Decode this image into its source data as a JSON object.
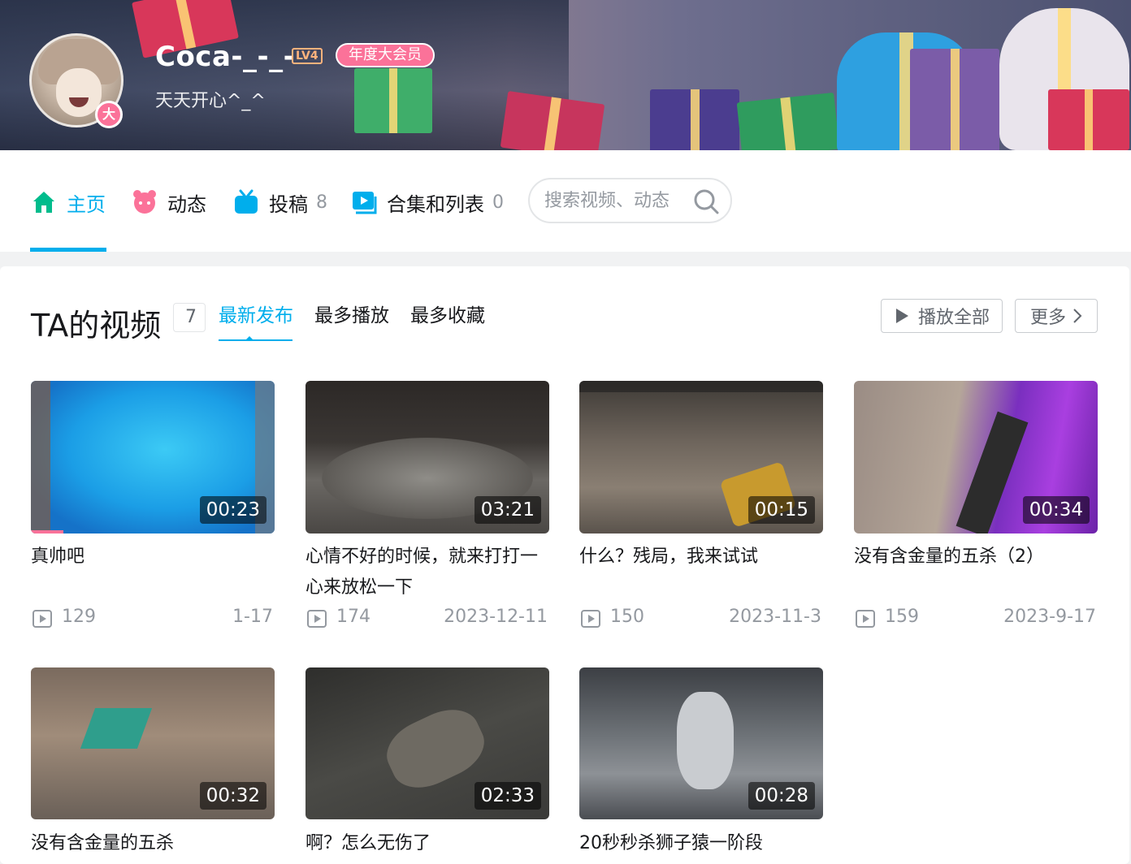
{
  "profile": {
    "username": "Coca-_-_-",
    "level": "LV4",
    "vip_label": "年度大会员",
    "vip_badge": "大",
    "signature": "天天开心^_^"
  },
  "nav": {
    "items": [
      {
        "label": "主页",
        "icon": "home-icon"
      },
      {
        "label": "动态",
        "icon": "dynamic-icon"
      },
      {
        "label": "投稿",
        "icon": "tv-icon",
        "count": "8"
      },
      {
        "label": "合集和列表",
        "icon": "collection-icon",
        "count": "0"
      }
    ],
    "search_placeholder": "搜索视频、动态"
  },
  "videos_section": {
    "title": "TA的视频",
    "count": "7",
    "sort_tabs": [
      "最新发布",
      "最多播放",
      "最多收藏"
    ],
    "play_all": "播放全部",
    "more": "更多"
  },
  "videos": [
    {
      "title": "真帅吧",
      "duration": "00:23",
      "plays": "129",
      "date": "1-17"
    },
    {
      "title": "心情不好的时候，就来打打一心来放松一下",
      "duration": "03:21",
      "plays": "174",
      "date": "2023-12-11"
    },
    {
      "title": "什么？残局，我来试试",
      "duration": "00:15",
      "plays": "150",
      "date": "2023-11-3"
    },
    {
      "title": "没有含金量的五杀（2）",
      "duration": "00:34",
      "plays": "159",
      "date": "2023-9-17"
    },
    {
      "title": "没有含金量的五杀",
      "duration": "00:32"
    },
    {
      "title": "啊？怎么无伤了",
      "duration": "02:33"
    },
    {
      "title": "20秒秒杀狮子猿一阶段",
      "duration": "00:28"
    }
  ],
  "colors": {
    "accent": "#00aeec",
    "vip_pink": "#fb7299",
    "level_orange": "#ffb37c"
  }
}
